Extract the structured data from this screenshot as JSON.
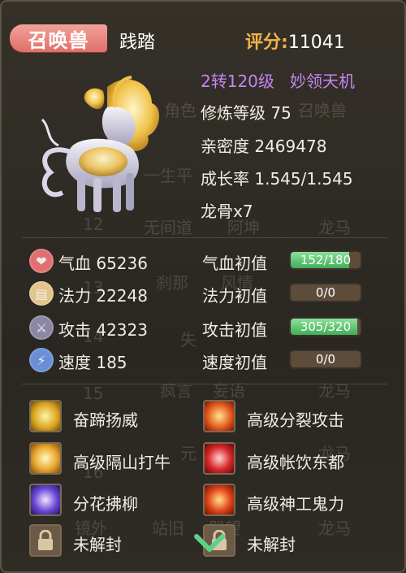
{
  "header": {
    "tag": "召唤兽",
    "pet_name": "践踏",
    "score_label": "评分:",
    "score_value": "11041"
  },
  "info": {
    "level": "2转120级",
    "title": "妙领天机",
    "cultivation": "修炼等级 75",
    "intimacy": "亲密度 2469478",
    "growth": "成长率 1.545/1.545",
    "dragon_bone": "龙骨x7"
  },
  "stats": [
    {
      "icon": "heart-icon",
      "label": "气血 65236",
      "base_label": "气血初值",
      "bar_text": "152/180",
      "fill": 0.84
    },
    {
      "icon": "mana-icon",
      "label": "法力 22248",
      "base_label": "法力初值",
      "bar_text": "0/0",
      "fill": 0
    },
    {
      "icon": "sword-icon",
      "label": "攻击 42323",
      "base_label": "攻击初值",
      "bar_text": "305/320",
      "fill": 0.95
    },
    {
      "icon": "lightning-icon",
      "label": "速度 185",
      "base_label": "速度初值",
      "bar_text": "0/0",
      "fill": 0
    }
  ],
  "skills": [
    {
      "name": "奋蹄扬威",
      "icon": "horse-skill-icon"
    },
    {
      "name": "高级分裂攻击",
      "icon": "fire-split-icon"
    },
    {
      "name": "高级隔山打牛",
      "icon": "burst-icon"
    },
    {
      "name": "高级帐饮东都",
      "icon": "flower-burst-icon"
    },
    {
      "name": "分花拂柳",
      "icon": "scroll-icon"
    },
    {
      "name": "高级神工鬼力",
      "icon": "flame-power-icon"
    },
    {
      "name": "未解封",
      "icon": "lock-icon"
    },
    {
      "name": "未解封",
      "icon": "lock-icon"
    }
  ],
  "background_list": [
    "角色",
    "召唤兽",
    "一生平",
    "12",
    "无间道",
    "阿坤",
    "龙马",
    "13",
    "刹那",
    "风情",
    "14",
    "失",
    "15",
    "疯言",
    "妄语",
    "龙马",
    "16",
    "元",
    "龙马",
    "镜外",
    "站旧",
    "哭望",
    "龙马"
  ],
  "colors": {
    "tag_bg": "#e06f67",
    "score_label": "#f0b347",
    "level_text": "#c884f2",
    "bar_fill": "#3fae57",
    "bar_bg": "#5e4c3a"
  }
}
